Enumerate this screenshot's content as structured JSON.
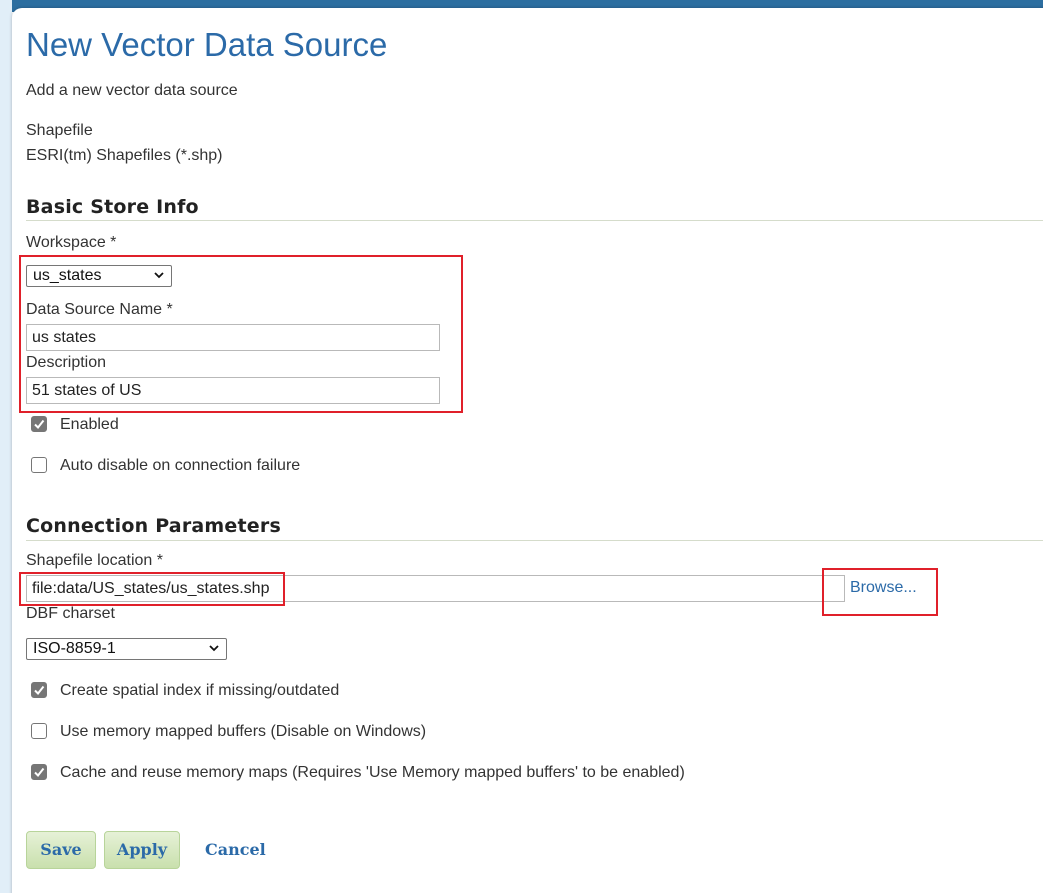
{
  "page": {
    "title": "New Vector Data Source",
    "subtitle": "Add a new vector data source",
    "store_type": "Shapefile",
    "store_description": "ESRI(tm) Shapefiles (*.shp)"
  },
  "basic_store_info": {
    "section_title": "Basic Store Info",
    "workspace_label": "Workspace *",
    "workspace_value": "us_states",
    "name_label": "Data Source Name *",
    "name_value": "us states",
    "description_label": "Description",
    "description_value": "51 states of US",
    "enabled_label": "Enabled",
    "enabled_checked": true,
    "auto_disable_label": "Auto disable on connection failure",
    "auto_disable_checked": false
  },
  "connection_parameters": {
    "section_title": "Connection Parameters",
    "shapefile_location_label": "Shapefile location *",
    "shapefile_location_value": "file:data/US_states/us_states.shp",
    "browse_label": "Browse...",
    "dbf_charset_label": "DBF charset",
    "dbf_charset_value": "ISO-8859-1",
    "options": [
      {
        "label": "Create spatial index if missing/outdated",
        "checked": true
      },
      {
        "label": "Use memory mapped buffers (Disable on Windows)",
        "checked": false
      },
      {
        "label": "Cache and reuse memory maps (Requires 'Use Memory mapped buffers' to be enabled)",
        "checked": true
      }
    ]
  },
  "actions": {
    "save_label": "Save",
    "apply_label": "Apply",
    "cancel_label": "Cancel"
  },
  "colors": {
    "title": "#2b6aa8",
    "highlight": "#e0202a",
    "button_bg": "#d3e6bd",
    "link": "#2b6aa8"
  },
  "icons": {
    "checkbox_checked": "checkmark-icon",
    "select_arrow": "chevron-down-icon"
  }
}
